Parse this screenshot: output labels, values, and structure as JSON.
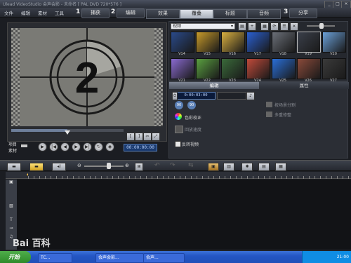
{
  "window": {
    "title": "Ulead VideoStudio 会声会影 - 未命名 [ PAL DVD 720*576 ]"
  },
  "menu": [
    "文件",
    "编辑",
    "素材",
    "工具"
  ],
  "steps": [
    {
      "num": "1",
      "label": "捕获"
    },
    {
      "num": "2",
      "label": "编辑"
    },
    {
      "num": "3",
      "label": "分享"
    }
  ],
  "tabs": [
    "效果",
    "覆叠",
    "标题",
    "音频"
  ],
  "active_tab": "覆叠",
  "preview": {
    "countdown": "2",
    "project_label": "项目",
    "clip_label": "素材",
    "timecode": "00:00:00:00"
  },
  "library": {
    "folder": "视频",
    "thumbs": [
      "V14",
      "V15",
      "V16",
      "V17",
      "V18",
      "V19",
      "V20",
      "V21",
      "V22",
      "V23",
      "V24",
      "V25",
      "V26",
      "V27"
    ],
    "thumb_colors": [
      "#2a4a8a",
      "#c79a2a",
      "#d9b040",
      "#2a5fd0",
      "#6a6f78",
      "#3a3f4a",
      "#6aa0d8",
      "#8a6ad0",
      "#5aa040",
      "#3a6a3a",
      "#c04a3a",
      "#2a6fd8",
      "#8a4a3a",
      "#3a3a3a"
    ]
  },
  "properties": {
    "tabs": [
      "编辑",
      "属性"
    ],
    "duration": "0:00:03:00",
    "rotate_left": "90",
    "rotate_right": "90",
    "color_correction": "色彩校正",
    "speed": "回放速度",
    "reverse_video": "反转视频",
    "split_scenes": "按场景分割",
    "multi_trim": "多重修整"
  },
  "timeline_tracks": [
    {
      "icon": "video-track-icon"
    },
    {
      "icon": "overlay-track-icon"
    },
    {
      "icon": "title-track-icon",
      "label": "T"
    },
    {
      "icon": "voice-track-icon"
    },
    {
      "icon": "music-track-icon"
    }
  ],
  "taskbar": {
    "start": "开始",
    "items": [
      "TC...",
      "会声会影...",
      "会声..."
    ],
    "clock": "21:00"
  },
  "watermark": "Bai 百科"
}
